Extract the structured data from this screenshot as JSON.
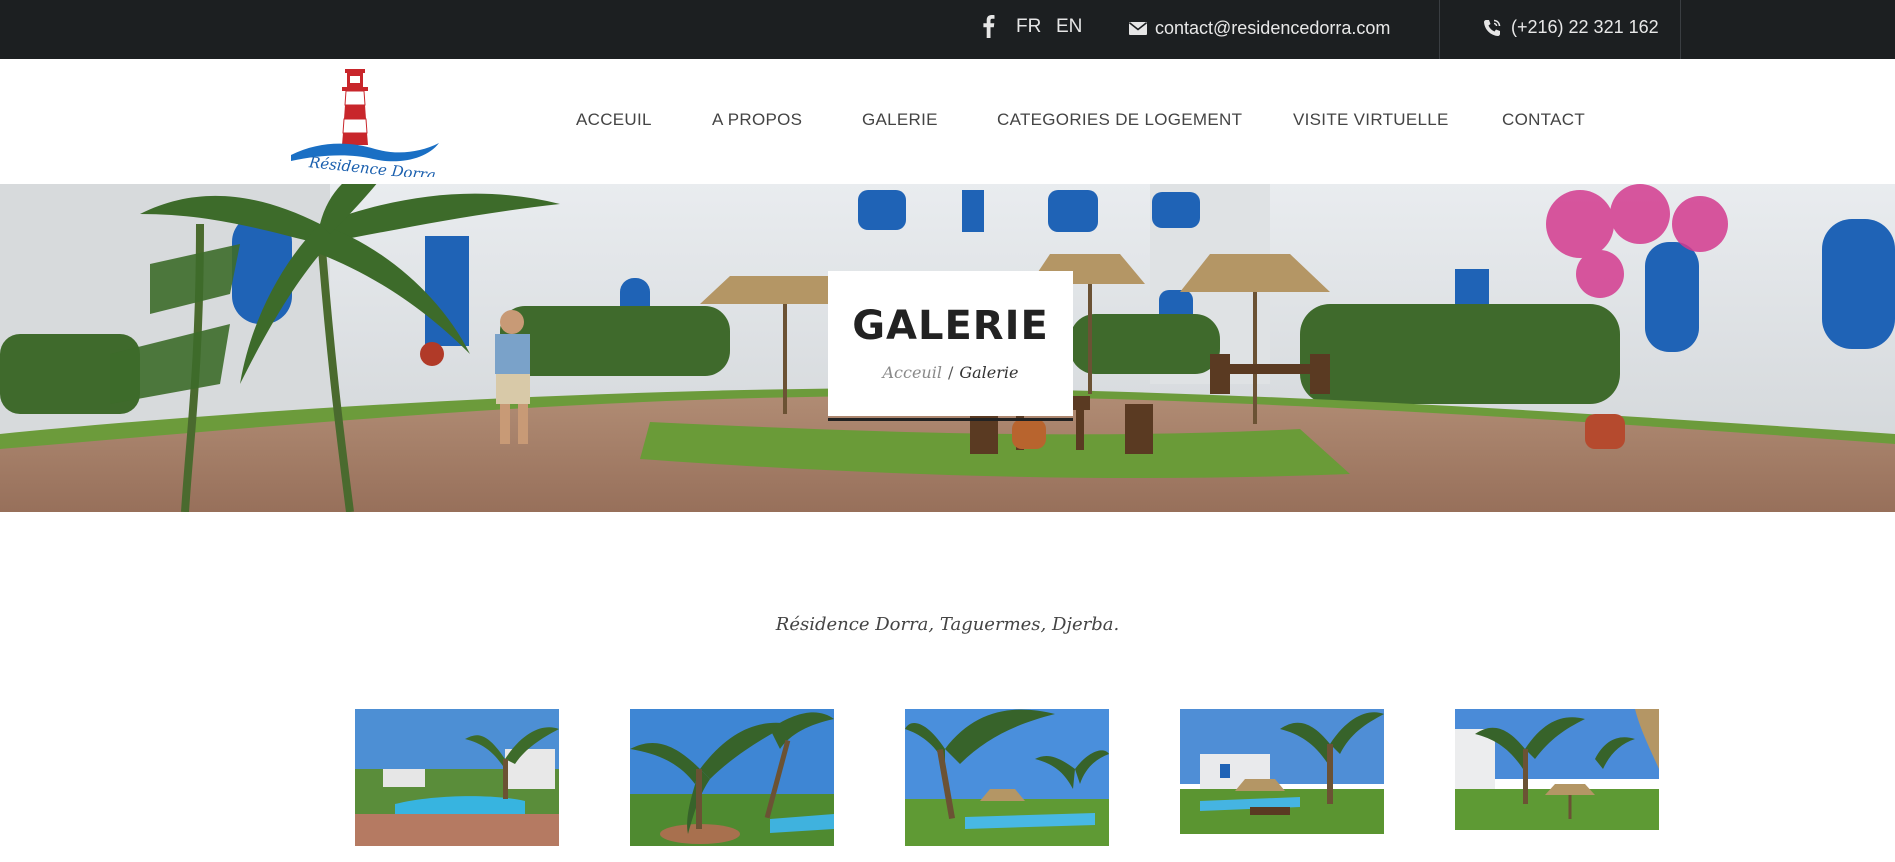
{
  "topbar": {
    "social_icon": "facebook-icon",
    "lang_fr": "FR",
    "lang_en": "EN",
    "email": "contact@residencedorra.com",
    "email_icon": "envelope-icon",
    "phone": "(+216) 22 321 162",
    "phone_icon": "phone-icon"
  },
  "logo": {
    "text": "Résidence Dorra",
    "colors": {
      "red": "#c8262b",
      "blue": "#1a6fc4"
    }
  },
  "nav": {
    "items": [
      "ACCEUIL",
      "A PROPOS",
      "GALERIE",
      "CATEGORIES DE LOGEMENT",
      "VISITE VIRTUELLE",
      "CONTACT"
    ]
  },
  "hero": {
    "title": "GALERIE",
    "breadcrumb": [
      "Acceuil",
      "/",
      "Galerie"
    ]
  },
  "tagline": "Résidence Dorra, Taguermes, Djerba.",
  "gallery": {
    "count": 5
  }
}
